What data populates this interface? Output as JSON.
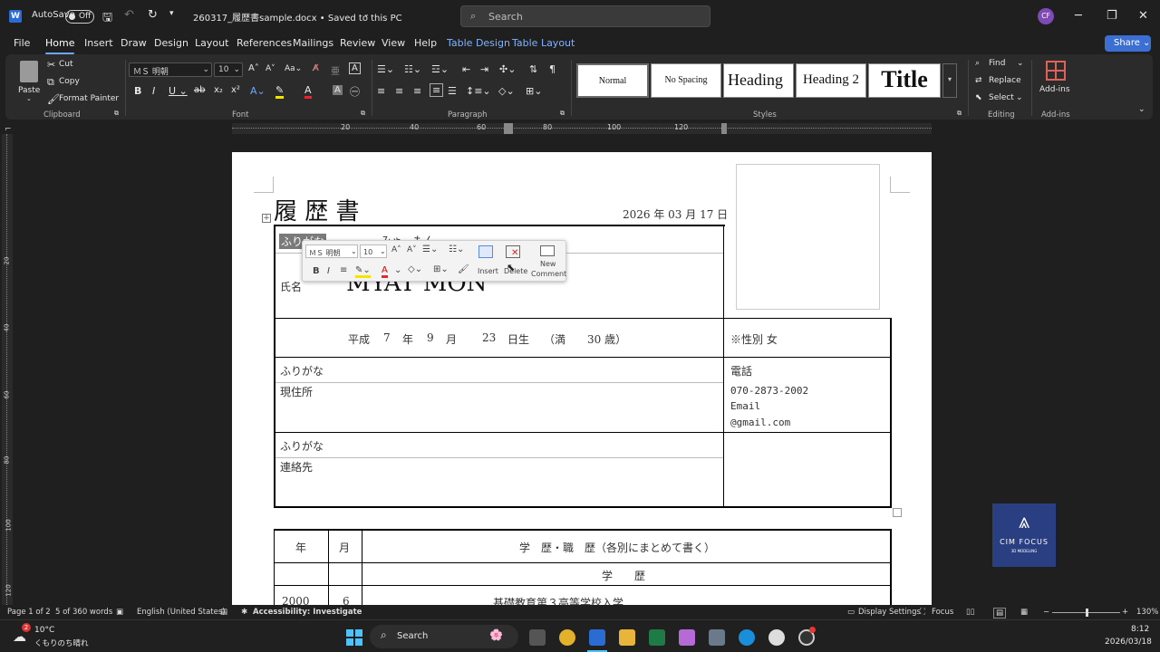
{
  "titlebar": {
    "autosave_label": "AutoSave",
    "autosave_state": "Off",
    "document_title": "260317_履歴書sample.docx • Saved to this PC",
    "search_placeholder": "Search",
    "user_initials": "CF"
  },
  "tabs": [
    "File",
    "Home",
    "Insert",
    "Draw",
    "Design",
    "Layout",
    "References",
    "Mailings",
    "Review",
    "View",
    "Help",
    "Table Design",
    "Table Layout"
  ],
  "share_label": "Share",
  "ribbon": {
    "clipboard": {
      "paste": "Paste",
      "cut": "Cut",
      "copy": "Copy",
      "format_painter": "Format Painter",
      "label": "Clipboard"
    },
    "font": {
      "name": "ＭＳ 明朝",
      "size": "10",
      "label": "Font"
    },
    "paragraph": {
      "label": "Paragraph"
    },
    "styles": {
      "items": [
        "Normal",
        "No Spacing",
        "Heading",
        "Heading 2",
        "Title"
      ],
      "label": "Styles"
    },
    "editing": {
      "find": "Find",
      "replace": "Replace",
      "select": "Select",
      "label": "Editing"
    },
    "addins": {
      "button": "Add-ins",
      "label": "Add-ins"
    }
  },
  "ruler": {
    "numbers": [
      "20",
      "40",
      "60",
      "80",
      "100",
      "120"
    ]
  },
  "vruler": {
    "numbers": [
      "20",
      "40",
      "60",
      "80",
      "100",
      "120"
    ]
  },
  "document": {
    "heading": "履 歴 書",
    "date": "2026 年 03 月 17 日",
    "furigana_label": "ふりがな",
    "furigana_value": "みゃ　もん",
    "name_label": "氏名",
    "name_value": "MYAT MON",
    "birth": {
      "era": "平成",
      "year": "7",
      "year_unit": "年",
      "month": "9",
      "month_unit": "月",
      "day": "23",
      "day_unit": "日生",
      "age_prefix": "（満",
      "age": "30 歳）"
    },
    "gender": "※性別 女",
    "address_furigana_label": "ふりがな",
    "address_label": "現住所",
    "phone_label": "電話",
    "phone_value": "070-2873-2002",
    "email_label": "Email",
    "email_value": "@gmail.com",
    "contact_furigana_label": "ふりがな",
    "contact_label": "連絡先",
    "history": {
      "col_year": "年",
      "col_month": "月",
      "col_desc": "学　歴・職　歴（各別にまとめて書く）",
      "section": "学　　歴",
      "row_year": "2000",
      "row_month": "6",
      "row_text": "基礎教育第３高等学校入学"
    }
  },
  "mini_toolbar": {
    "font": "ＭＳ 明朝",
    "size": "10",
    "insert": "Insert",
    "delete": "Delete",
    "new_comment_1": "New",
    "new_comment_2": "Comment"
  },
  "logo": {
    "line1": "CIM FOCUS",
    "line2": "3D MODELING"
  },
  "status": {
    "page": "Page 1 of 2",
    "words": "5 of 360 words",
    "language": "English (United States)",
    "accessibility": "Accessibility: Investigate",
    "display_settings": "Display Settings",
    "focus": "Focus",
    "zoom": "130%"
  },
  "taskbar": {
    "temp": "10°C",
    "weather": "くもりのち晴れ",
    "weather_badge": "2",
    "search": "Search",
    "time": "8:12",
    "date": "2026/03/18"
  }
}
